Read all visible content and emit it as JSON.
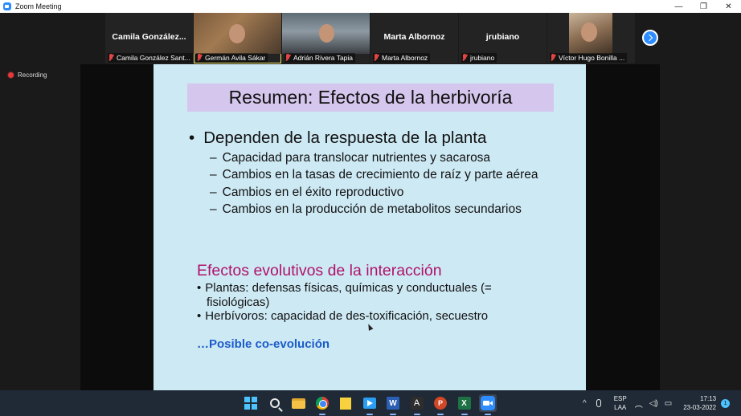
{
  "window": {
    "title": "Zoom Meeting",
    "controls": [
      "—",
      "❐",
      "✕"
    ]
  },
  "participants": [
    {
      "big_name": "Camila  González...",
      "label": "Camila González Sant...",
      "muted": true,
      "video": false
    },
    {
      "big_name": "",
      "label": "Germán Avila Sákar",
      "muted": true,
      "video": true,
      "active_speaker": true
    },
    {
      "big_name": "",
      "label": "Adrián Rivera Tapia",
      "muted": true,
      "video": true
    },
    {
      "big_name": "Marta Albornoz",
      "label": "Marta Albornoz",
      "muted": true,
      "video": false
    },
    {
      "big_name": "jrubiano",
      "label": "jrubiano",
      "muted": true,
      "video": false
    },
    {
      "big_name": "",
      "label": "Víctor Hugo Bonilla ...",
      "muted": true,
      "video": true
    }
  ],
  "recording_label": "Recording",
  "slide": {
    "title": "Resumen: Efectos de la herbivoría",
    "bullet": "Dependen de la respuesta de la planta",
    "sub_bullets": [
      "Capacidad para translocar nutrientes y sacarosa",
      "Cambios en la tasas de crecimiento de raíz y parte aérea",
      "Cambios en el éxito reproductivo",
      "Cambios en la producción de metabolitos secundarios"
    ],
    "section2_heading": "Efectos evolutivos de la interacción",
    "section2_bullets": [
      {
        "line1": "Plantas: defensas físicas, químicas y conductuales (=",
        "line2": "fisiológicas)"
      },
      {
        "line1": "Herbívoros: capacidad de des-toxificación, secuestro",
        "line2": ""
      }
    ],
    "closing": "…Posible co-evolución",
    "bullet_glyph": "•",
    "dash_glyph": "–"
  },
  "taskbar": {
    "apps": [
      "start-icon",
      "search-icon",
      "file-explorer-icon",
      "chrome-icon",
      "sticky-notes-icon",
      "media-icon",
      "word-icon",
      "acrobat-icon",
      "powerpoint-icon",
      "excel-icon",
      "zoom-icon"
    ],
    "word_glyph": "W",
    "ppt_glyph": "P",
    "excel_glyph": "X",
    "acrobat_glyph": "A",
    "language_top": "ESP",
    "language_bottom": "LAA",
    "time": "17:13",
    "date": "23-03-2022",
    "notification_count": "1",
    "tray_chevron": "^"
  },
  "colors": {
    "zoom_blue": "#2d8cff",
    "slide_bg": "#cde9f4",
    "title_box": "#d4c6ec",
    "heading_magenta": "#b0126a",
    "closing_blue": "#1c5cc9"
  }
}
